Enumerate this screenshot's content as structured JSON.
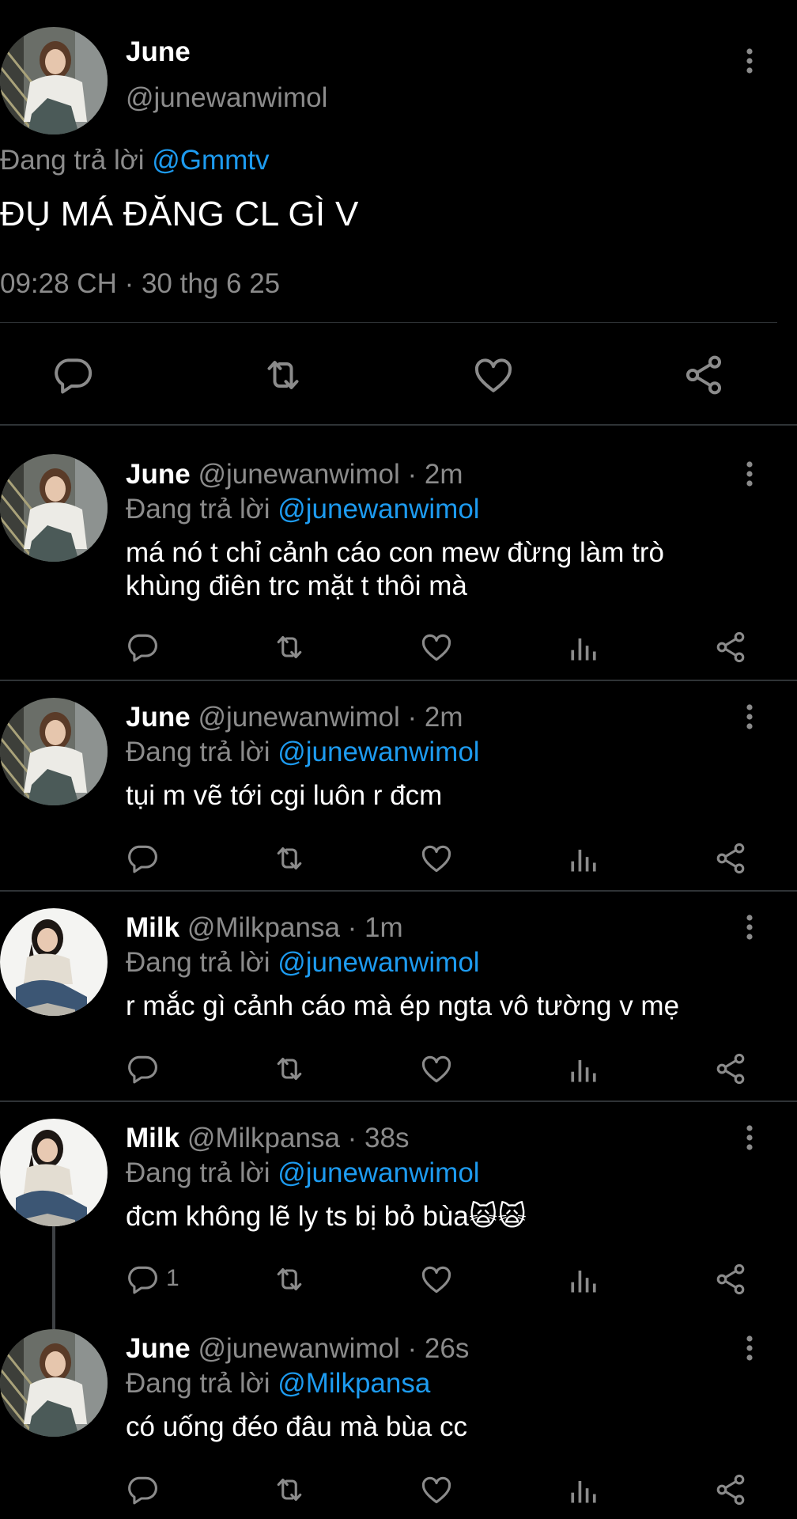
{
  "main_tweet": {
    "name": "June",
    "handle": "@junewanwimol",
    "replying_prefix": "Đang trả lời",
    "replying_to": "@Gmmtv",
    "text": "ĐỤ MÁ ĐĂNG CL GÌ V",
    "timestamp": "09:28 CH · 30 thg 6 25",
    "actions": [
      "reply-icon",
      "retweet-icon",
      "like-icon",
      "share-icon"
    ]
  },
  "replies": [
    {
      "name": "June",
      "handle": "@junewanwimol · 2m",
      "replying_prefix": "Đang trả lời",
      "replying_to": "@junewanwimol",
      "text_line1": "má nó t chỉ cảnh cáo con mew đừng làm trò",
      "text_line2": "khùng điên trc mặt t thôi mà",
      "reply_count": ""
    },
    {
      "name": "June",
      "handle": "@junewanwimol · 2m",
      "replying_prefix": "Đang trả lời",
      "replying_to": "@junewanwimol",
      "text_line1": "tụi m vẽ tới cgi luôn r đcm",
      "text_line2": "",
      "reply_count": ""
    },
    {
      "name": "Milk",
      "handle": "@Milkpansa · 1m",
      "replying_prefix": "Đang trả lời",
      "replying_to": "@junewanwimol",
      "text_line1": "r mắc gì cảnh cáo mà ép ngta vô tường v mẹ",
      "text_line2": "",
      "reply_count": ""
    },
    {
      "name": "Milk",
      "handle": "@Milkpansa · 38s",
      "replying_prefix": "Đang trả lời",
      "replying_to": "@junewanwimol",
      "text_line1": "đcm không lẽ ly ts bị bỏ bùa🙀🙀",
      "text_line2": "",
      "reply_count": "1"
    },
    {
      "name": "June",
      "handle": "@junewanwimol · 26s",
      "replying_prefix": "Đang trả lời",
      "replying_to": "@Milkpansa",
      "text_line1": "có uống đéo đâu mà bùa cc",
      "text_line2": "",
      "reply_count": ""
    }
  ],
  "colors": {
    "background": "#000000",
    "text": "#ffffff",
    "secondary": "#8b8b8b",
    "link": "#1d9bf0",
    "divider": "#2f3336"
  }
}
